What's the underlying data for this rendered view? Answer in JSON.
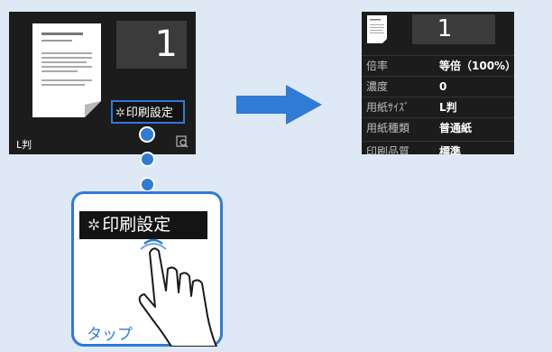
{
  "left_screen": {
    "copies": "1",
    "print_settings_label": "印刷設定",
    "paper_size": "L判"
  },
  "callout": {
    "print_settings_label": "印刷設定",
    "tap_label": "タップ"
  },
  "right_screen": {
    "copies": "1",
    "settings": [
      {
        "label": "倍率",
        "value": "等倍（100%）"
      },
      {
        "label": "濃度",
        "value": "0"
      },
      {
        "label": "用紙ｻｲｽﾞ",
        "value": "L判"
      },
      {
        "label": "用紙種類",
        "value": "普通紙"
      },
      {
        "label": "印刷品質",
        "value": "標準"
      }
    ]
  },
  "colors": {
    "accent": "#2f7bd6",
    "background": "#dfe8f5",
    "screen": "#1c1c1c"
  }
}
